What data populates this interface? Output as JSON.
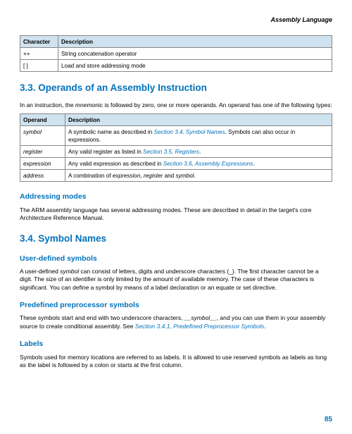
{
  "header": {
    "title": "Assembly Language"
  },
  "table1": {
    "h1": "Character",
    "h2": "Description",
    "r1c1": "++",
    "r1c2": "String concatenation operator",
    "r2c1": "[ ]",
    "r2c2": "Load and store addressing mode"
  },
  "sec33": {
    "heading": "3.3. Operands of an Assembly Instruction",
    "intro": "In an instruction, the mnemonic is followed by zero, one or more operands. An operand has one of the following types:"
  },
  "table2": {
    "h1": "Operand",
    "h2": "Description",
    "r1c1": "symbol",
    "r1c2a": "A symbolic name as described in ",
    "r1c2link": "Section 3.4, Symbol Names",
    "r1c2b": ". Symbols can also occur in expressions.",
    "r2c1": "register",
    "r2c2a": "Any valid register as listed in ",
    "r2c2link": "Section 3.5, Registers",
    "r2c2b": ".",
    "r3c1": "expression",
    "r3c2a": "Any valid expression as described in ",
    "r3c2link": "Section 3.6, Assembly Expressions",
    "r3c2b": ".",
    "r4c1": "address",
    "r4c2a": "A combination of ",
    "r4c2i1": "expression",
    "r4c2m": ", ",
    "r4c2i2": "register",
    "r4c2m2": " and ",
    "r4c2i3": "symbol",
    "r4c2e": "."
  },
  "addr": {
    "heading": "Addressing modes",
    "body": "The ARM assembly language has several addressing modes. These are described in detail in the target's core Architecture Reference Manual."
  },
  "sec34": {
    "heading": "3.4. Symbol Names"
  },
  "uds": {
    "heading": "User-defined symbols",
    "p1a": "A user-defined ",
    "p1i": "symbol",
    "p1b": " can consist of letters, digits and underscore characters (_). The first character cannot be a digit. The size of an identifier is only limited by the amount of available memory. The case of these characters is significant. You can define a symbol by means of a label declaration or an equate or set directive."
  },
  "pps": {
    "heading": "Predefined preprocessor symbols",
    "p1a": "These symbols start and end with two underscore characters, ",
    "p1i": "__symbol__",
    "p1b": ", and you can use them in your assembly source to create conditional assembly. See ",
    "p1link": "Section 3.4.1, Predefined Preprocessor Symbols",
    "p1e": "."
  },
  "labels": {
    "heading": "Labels",
    "body": "Symbols used for memory locations are referred to as labels. It is allowed to use reserved symbols as labels as long as the label is followed by a colon or starts at the first column."
  },
  "pagenum": "85"
}
